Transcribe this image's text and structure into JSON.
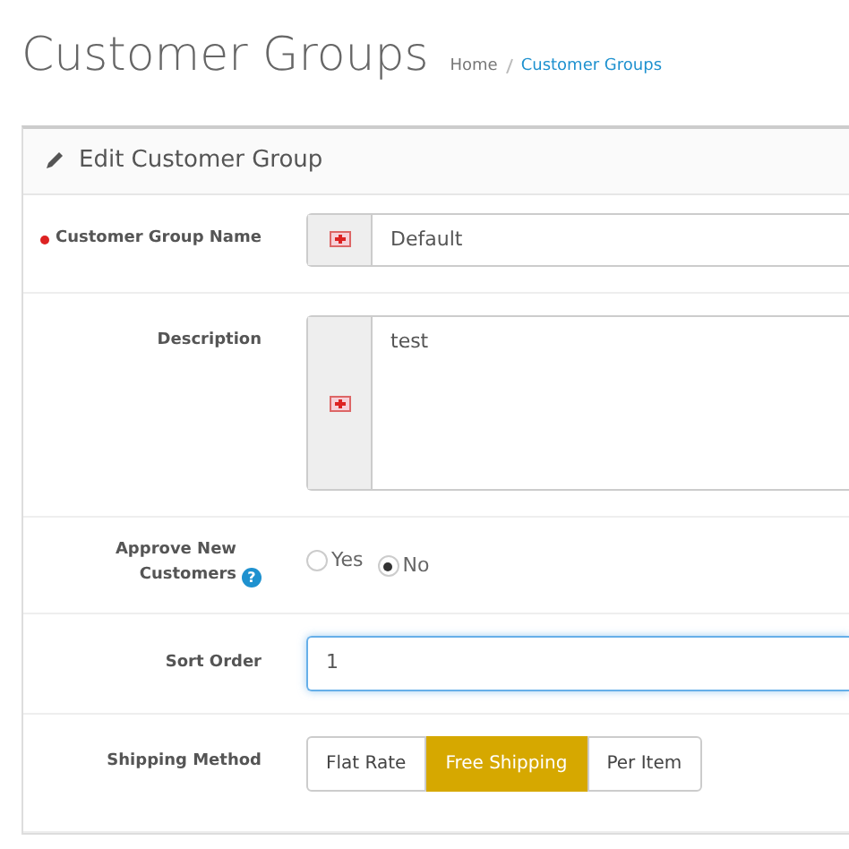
{
  "page_title": "Customer Groups",
  "breadcrumb": [
    {
      "label": "Home",
      "selected": false
    },
    {
      "label": "Customer Groups",
      "selected": true
    }
  ],
  "panel": {
    "title": "Edit Customer Group"
  },
  "form": [
    {
      "kind": "addon-input",
      "label": "Customer Group Name",
      "required": true,
      "value": "Default"
    },
    {
      "kind": "addon-textarea",
      "label": "Description",
      "required": false,
      "value": "test"
    },
    {
      "kind": "radios",
      "label": "Approve New Customers",
      "help": "?",
      "required": false,
      "options": [
        {
          "label": "Yes",
          "selected": false
        },
        {
          "label": "No",
          "selected": true
        }
      ]
    },
    {
      "kind": "input",
      "label": "Sort Order",
      "required": false,
      "value": "1",
      "focused": true
    },
    {
      "kind": "button-group",
      "label": "Shipping Method",
      "required": false,
      "options": [
        {
          "label": "Flat Rate",
          "selected": false
        },
        {
          "label": "Free Shipping",
          "selected": true
        },
        {
          "label": "Per Item",
          "selected": false
        }
      ]
    }
  ]
}
